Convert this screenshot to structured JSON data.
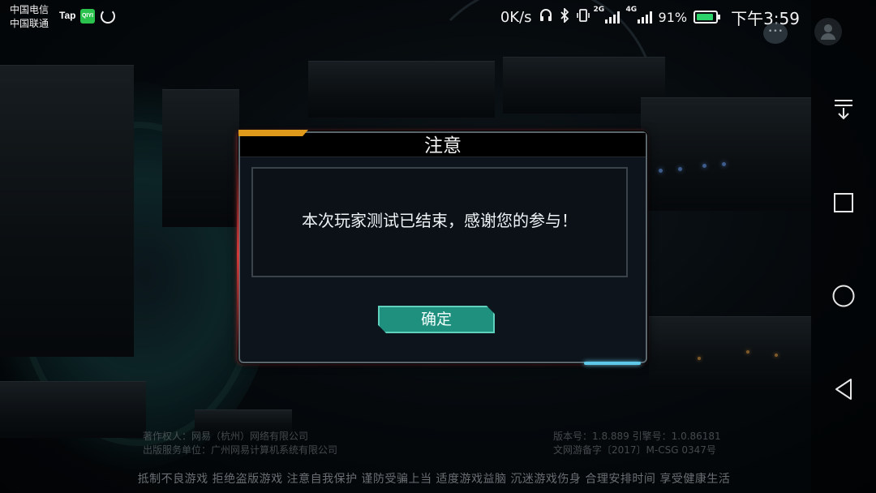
{
  "status_bar": {
    "carrier_1": "中国电信",
    "carrier_2": "中国联通",
    "tap_label": "Tap",
    "iqiyi_label": "QIYI",
    "net_speed": "0K/s",
    "net_2g": "2G",
    "net_4g": "4G",
    "battery_percent": "91%",
    "battery_level": 0.91,
    "time": "下午3:59"
  },
  "dialog": {
    "title": "注意",
    "message": "本次玩家测试已结束，感谢您的参与！",
    "confirm_label": "确定"
  },
  "footer": {
    "legal_left": [
      "著作权人：网易（杭州）网络有限公司",
      "出版服务单位：广州网易计算机系统有限公司"
    ],
    "legal_right": [
      "版本号：1.8.889  引擎号：1.0.86181",
      "文网游备字〔2017〕M-CSG 0347号"
    ],
    "health_notice": "抵制不良游戏  拒绝盗版游戏  注意自我保护  谨防受骗上当  适度游戏益脑  沉迷游戏伤身  合理安排时间  享受健康生活"
  },
  "colors": {
    "dialog_bg": "#0d141b",
    "confirm_bg": "#1f8f7e",
    "confirm_border": "#5fd1bd",
    "tab_accent": "#e09a1b",
    "red_glow": "#e63c3c",
    "cyan_glow": "#5ec9e8"
  },
  "icons": {
    "headset": "headset-icon",
    "bluetooth": "bluetooth-icon",
    "vibrate": "vibrate-icon",
    "nav_drawer": "pull-down-icon",
    "nav_recent": "square-recent-icon",
    "nav_home": "circle-home-icon",
    "nav_back": "triangle-back-icon"
  }
}
